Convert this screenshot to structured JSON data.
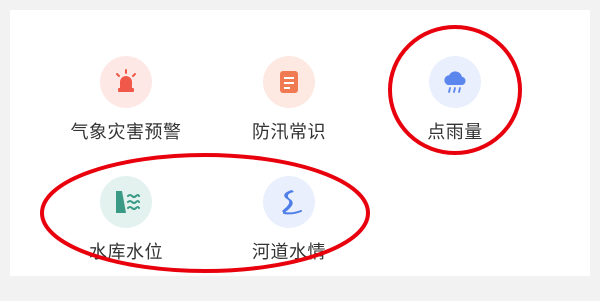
{
  "menu": {
    "items": [
      {
        "label": "气象灾害预警",
        "icon": "alarm-light-icon",
        "color": "#f0584a"
      },
      {
        "label": "防汛常识",
        "icon": "notebook-icon",
        "color": "#f07a52"
      },
      {
        "label": "点雨量",
        "icon": "rain-cloud-icon",
        "color": "#5b86ee"
      },
      {
        "label": "水库水位",
        "icon": "reservoir-dam-icon",
        "color": "#3a9a86"
      },
      {
        "label": "河道水情",
        "icon": "river-icon",
        "color": "#4f7ee8"
      }
    ]
  },
  "annotation_color": "#e8000d"
}
